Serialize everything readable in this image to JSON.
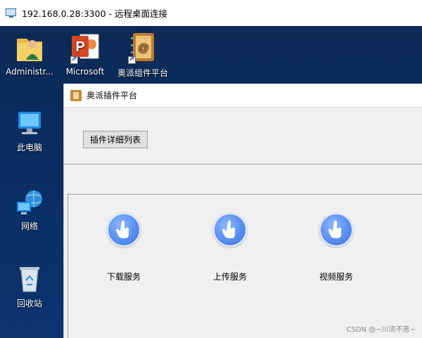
{
  "rdp": {
    "title": "192.168.0.28:3300 - 远程桌面连接"
  },
  "desktop": {
    "icons": [
      {
        "label": "Administr...",
        "icon": "user-folder-icon"
      },
      {
        "label": "Microsoft",
        "icon": "powerpoint-icon"
      },
      {
        "label": "奥派组件平台",
        "icon": "address-book-icon"
      },
      {
        "label": "此电脑",
        "icon": "computer-icon"
      },
      {
        "label": "网络",
        "icon": "network-icon"
      },
      {
        "label": "回收站",
        "icon": "recycle-bin-icon"
      }
    ]
  },
  "app": {
    "title": "奥派插件平台",
    "detail_button": "插件详细列表",
    "services": [
      {
        "label": "下载服务",
        "icon": "hand-pointer-icon"
      },
      {
        "label": "上传服务",
        "icon": "hand-pointer-icon"
      },
      {
        "label": "视频服务",
        "icon": "hand-pointer-icon"
      }
    ]
  },
  "watermark": "CSDN @~川流不息~",
  "colors": {
    "desktop_bg": "#0a2d63",
    "service_blue": "#5a8ff0",
    "window_bg": "#f0f0f0"
  }
}
